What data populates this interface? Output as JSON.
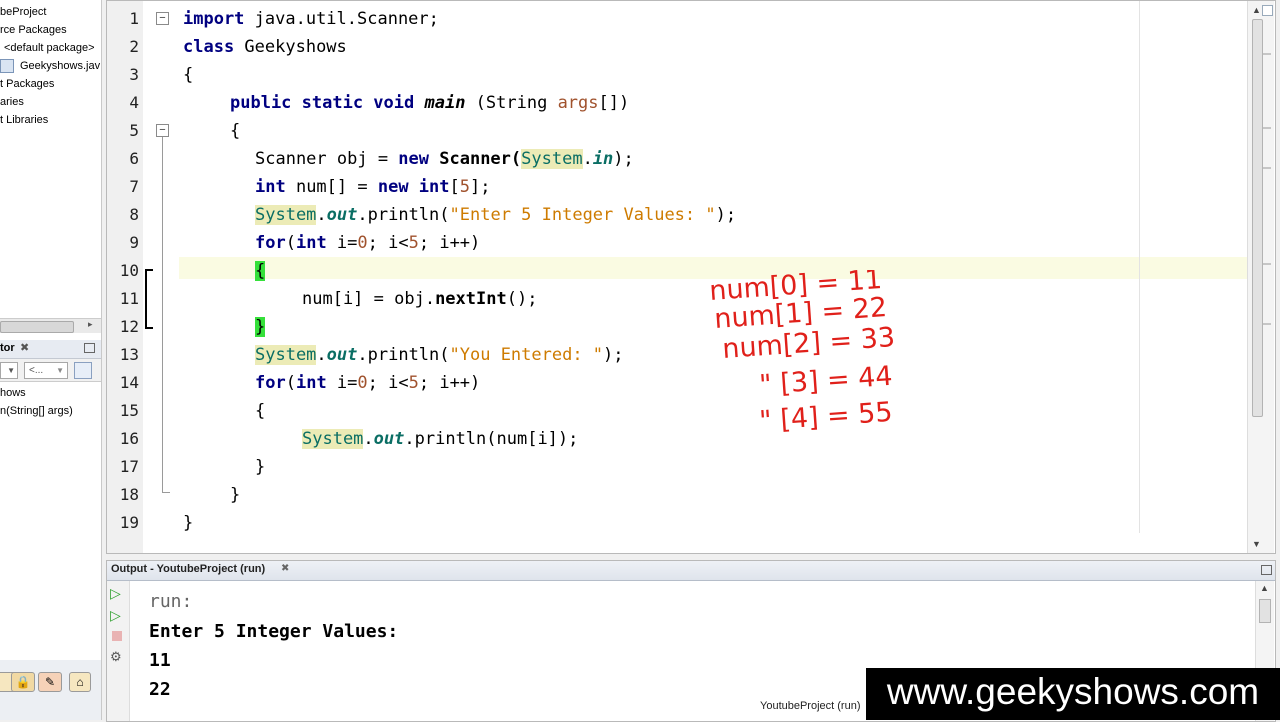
{
  "project_panel": {
    "items": [
      "beProject",
      "rce Packages",
      "<default package>",
      "Geekyshows.jav",
      "t Packages",
      "aries",
      "t Libraries"
    ]
  },
  "navigator": {
    "title": "tor",
    "combo_left": "",
    "combo_right": "<...",
    "items": [
      "hows",
      "n(String[] args)"
    ]
  },
  "editor": {
    "lines": [
      {
        "n": "1"
      },
      {
        "n": "2"
      },
      {
        "n": "3"
      },
      {
        "n": "4"
      },
      {
        "n": "5"
      },
      {
        "n": "6"
      },
      {
        "n": "7"
      },
      {
        "n": "8"
      },
      {
        "n": "9"
      },
      {
        "n": "10"
      },
      {
        "n": "11"
      },
      {
        "n": "12"
      },
      {
        "n": "13"
      },
      {
        "n": "14"
      },
      {
        "n": "15"
      },
      {
        "n": "16"
      },
      {
        "n": "17"
      },
      {
        "n": "18"
      },
      {
        "n": "19"
      }
    ],
    "code": {
      "l1_kw": "import",
      "l1_rest": " java.util.Scanner;",
      "l2_kw": "class",
      "l2_rest": " Geekyshows",
      "l3": "{",
      "l4_kw": "public static void",
      "l4_main": "main",
      "l4_rest": " (String ",
      "l4_args": "args",
      "l4_end": "[])",
      "l5": "{",
      "l6_a": "Scanner obj = ",
      "l6_new": "new",
      "l6_b": " Scanner(",
      "l6_sys": "System",
      "l6_dot": ".",
      "l6_in": "in",
      "l6_end": ");",
      "l7_int": "int",
      "l7_a": " num[] = ",
      "l7_new": "new",
      "l7_int2": " int",
      "l7_b": "[",
      "l7_num": "5",
      "l7_end": "];",
      "l8_sys": "System",
      "l8_dot": ".",
      "l8_out": "out",
      "l8_m": ".println(",
      "l8_str": "\"Enter 5 Integer Values: \"",
      "l8_end": ");",
      "l9_for": "for",
      "l9_a": "(",
      "l9_int": "int",
      "l9_b": " i=",
      "l9_n0": "0",
      "l9_c": "; i<",
      "l9_n5": "5",
      "l9_d": "; i++)",
      "l10": "{",
      "l11_a": "num[i] = obj.",
      "l11_m": "nextInt",
      "l11_end": "();",
      "l12": "}",
      "l13_sys": "System",
      "l13_dot": ".",
      "l13_out": "out",
      "l13_m": ".println(",
      "l13_str": "\"You Entered: \"",
      "l13_end": ");",
      "l14_for": "for",
      "l14_a": "(",
      "l14_int": "int",
      "l14_b": " i=",
      "l14_n0": "0",
      "l14_c": "; i<",
      "l14_n5": "5",
      "l14_d": "; i++)",
      "l15": "{",
      "l16_sys": "System",
      "l16_dot": ".",
      "l16_out": "out",
      "l16_m": ".println(num[i]);",
      "l17": "}",
      "l18": "}",
      "l19": "}"
    }
  },
  "annotation": {
    "lines": [
      "num[0] = 11",
      "num[1] = 22",
      "num[2] = 33",
      "\" [3] = 44",
      "\" [4] = 55"
    ],
    "color": "#e0201a"
  },
  "output": {
    "tab_title": "Output - YoutubeProject (run)",
    "lines": [
      "run:",
      "Enter 5 Integer Values:",
      "11",
      "22"
    ]
  },
  "status_bar": {
    "project": "YoutubeProject (run)"
  },
  "watermark": "www.geekyshows.com",
  "colors": {
    "keyword": "#000080",
    "string": "#ce7b00",
    "highlight_bracket": "#35e03a",
    "system_bg": "#ecebb6"
  }
}
